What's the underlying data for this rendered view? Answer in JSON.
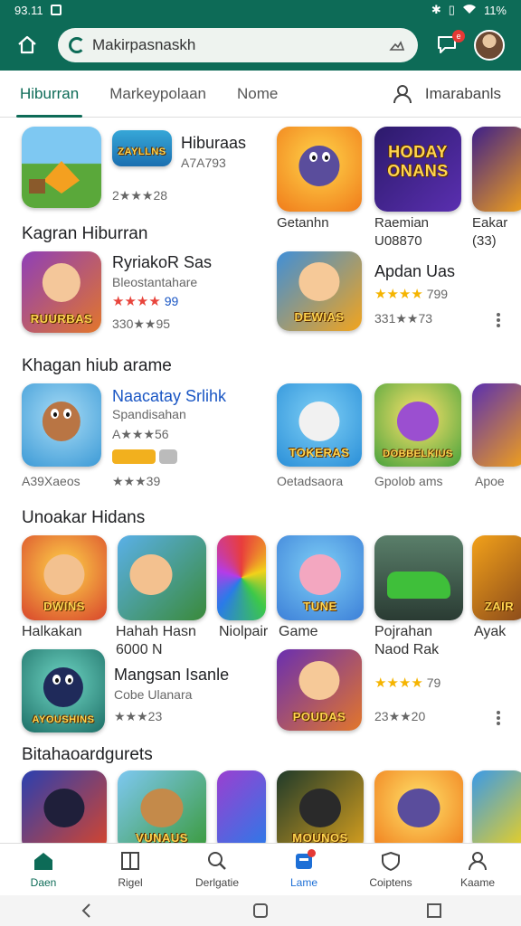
{
  "status_bar": {
    "time": "93.11",
    "battery": "11%"
  },
  "search": {
    "value": "Makirpasnaskh"
  },
  "tabs": [
    "Hiburran",
    "Markeypolaan",
    "Nome"
  ],
  "tab_right_label": "Imarabanls",
  "row1": {
    "app1": {
      "title": "Hiburaas",
      "rating": "A7A793",
      "icon_caption": "ZAYLLNS"
    },
    "app1_rating_line": "2★★★28",
    "cards": [
      {
        "title": "Getanhn",
        "sub": ""
      },
      {
        "title": "Raemian",
        "sub": "U08870",
        "icon_caption": "HODAY ONANS"
      },
      {
        "title": "Eakar",
        "sub": "(33)"
      }
    ]
  },
  "section1": {
    "title": "Kagran Hiburran",
    "app_left": {
      "title": "RyriakoR Sas",
      "sub": "Bleostantahare",
      "stars": "★★★★",
      "rating_value": "99",
      "rating_line": "330★★95",
      "icon_caption": "RUURBAS"
    },
    "app_right": {
      "title": "Apdan Uas",
      "stars": "★★★★",
      "rating_value": "799",
      "rating_line": "331★★73",
      "icon_caption": "DEWIAS"
    }
  },
  "section2": {
    "title": "Khagan hiub arame",
    "app_left": {
      "title": "Naacatay Srlihk",
      "sub": "Spandisahan",
      "rating_line1": "A★★★56",
      "rating_line2": "A39Xaeos",
      "rating_line3": "★★★39"
    },
    "cards": [
      {
        "title": "Oetadsaora",
        "icon_caption": "TOKERAS"
      },
      {
        "title": "Gpolob ams",
        "icon_caption": "DOBBELKIUS"
      },
      {
        "title": "Apoe"
      }
    ]
  },
  "section3": {
    "title": "Unoakar Hidans",
    "cards": [
      {
        "title": "Halkakan",
        "icon_caption": "DWINS"
      },
      {
        "title": "Hahah Hasn",
        "sub": "6000 N"
      },
      {
        "title": "Niolpair"
      },
      {
        "title": "Game",
        "icon_caption": "TUNE"
      },
      {
        "title": "Pojrahan",
        "sub": "Naod Rak"
      },
      {
        "title": "Ayak",
        "icon_caption": "ZAIR"
      }
    ],
    "app_left": {
      "title": "Mangsan Isanle",
      "sub": "Cobe Ulanara",
      "rating_line": "★★★23",
      "icon_caption": "AYOUSHINS"
    },
    "app_right": {
      "stars": "★★★★",
      "rating_value": "79",
      "rating_line": "23★★20",
      "icon_caption": "POUDAS"
    }
  },
  "section4": {
    "title": "Bitahaoardgurets",
    "icon_captions": [
      "",
      "VUNAUS",
      "",
      "MOUNOS",
      "",
      ""
    ]
  },
  "bottom_nav": [
    "Daen",
    "Rigel",
    "Derlgatie",
    "Lame",
    "Coiptens",
    "Kaame"
  ],
  "colors": {
    "brand": "#0d6b57",
    "accent": "#1d6fd6",
    "star": "#f5b400"
  }
}
